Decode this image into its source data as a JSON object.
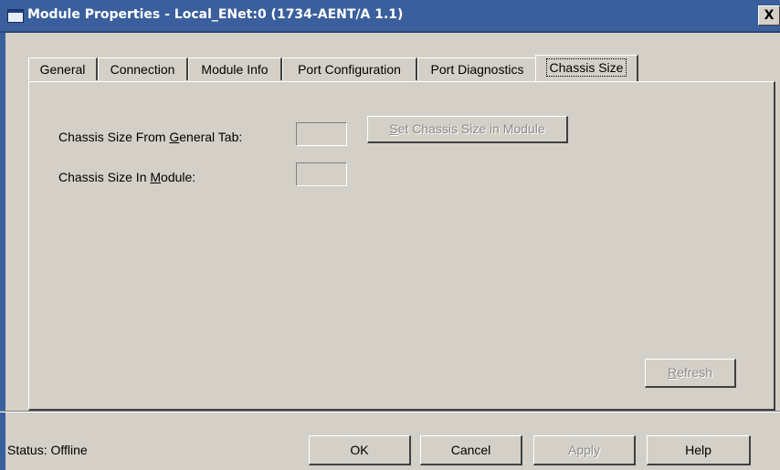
{
  "window": {
    "title": "Module Properties - Local_ENet:0 (1734-AENT/A 1.1)",
    "close_glyph": "X"
  },
  "tabs": [
    {
      "label": "General"
    },
    {
      "label": "Connection"
    },
    {
      "label": "Module Info"
    },
    {
      "label": "Port Configuration"
    },
    {
      "label": "Port Diagnostics"
    },
    {
      "label": "Chassis Size",
      "active": true
    }
  ],
  "chassis": {
    "from_general_prefix": "Chassis Size From ",
    "from_general_key": "G",
    "from_general_suffix": "eneral Tab:",
    "from_general_value": "",
    "in_module_prefix": "Chassis Size In ",
    "in_module_key": "M",
    "in_module_suffix": "odule:",
    "in_module_value": "",
    "set_button_key": "S",
    "set_button_rest": "et Chassis Size in Module",
    "refresh_key": "R",
    "refresh_rest": "efresh"
  },
  "footer": {
    "status": "Status:  Offline",
    "ok": "OK",
    "cancel": "Cancel",
    "apply": "Apply",
    "help": "Help"
  }
}
